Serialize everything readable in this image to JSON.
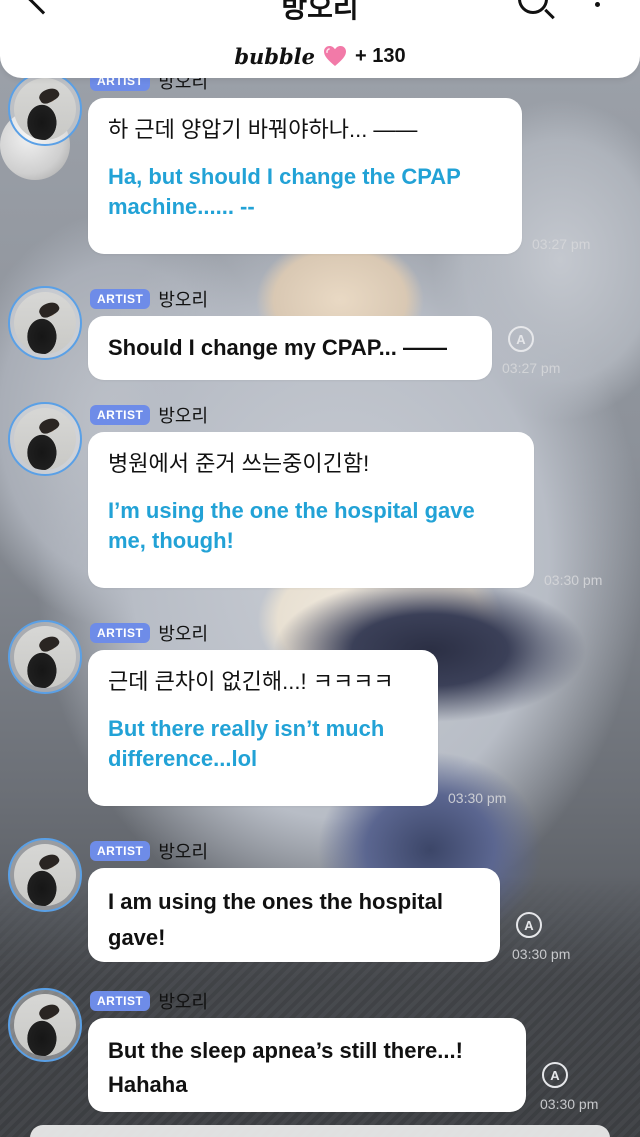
{
  "header": {
    "title": "방오리",
    "brand": "bubble",
    "count": "+ 130",
    "heart_color": "#f27aa8"
  },
  "messages": [
    {
      "badge": "ARTIST",
      "name": "방오리",
      "original": "하 근데 양압기 바꿔야하나... ——",
      "translation": "Ha, but should I change the CPAP machine...... --",
      "time": "03:27 pm"
    },
    {
      "badge": "ARTIST",
      "name": "방오리",
      "original": "Should I change my CPAP... ——",
      "time": "03:27 pm",
      "auto_translated": true
    },
    {
      "badge": "ARTIST",
      "name": "방오리",
      "original": "병원에서 준거 쓰는중이긴함!",
      "translation": "I’m using the one the hospital gave me, though!",
      "time": "03:30 pm"
    },
    {
      "badge": "ARTIST",
      "name": "방오리",
      "original": "근데 큰차이 없긴해...! ㅋㅋㅋㅋ",
      "translation": "But there really isn’t much difference...lol",
      "time": "03:30 pm"
    },
    {
      "badge": "ARTIST",
      "name": "방오리",
      "original": "I am using the ones the hospital gave!",
      "time": "03:30 pm",
      "auto_translated": true
    },
    {
      "badge": "ARTIST",
      "name": "방오리",
      "original": "But the sleep apnea’s still there...! Hahaha",
      "time": "03:30 pm",
      "auto_translated": true
    }
  ],
  "icons": {
    "translate": "A"
  }
}
